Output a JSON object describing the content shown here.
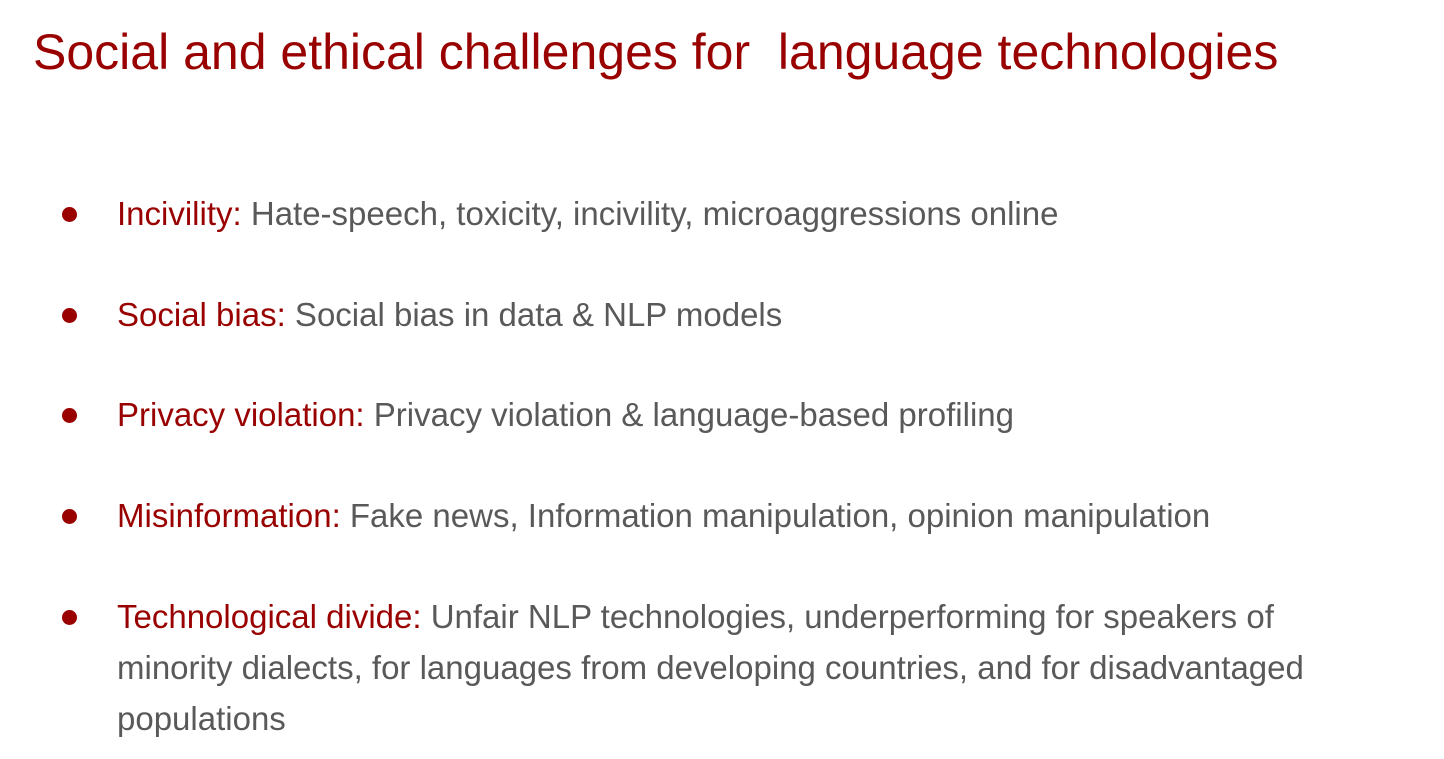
{
  "slide": {
    "title": "Social and ethical challenges for  language technologies",
    "bullets": [
      {
        "term": "Incivility:",
        "description": " Hate-speech, toxicity, incivility, microaggressions online"
      },
      {
        "term": "Social bias:",
        "description": " Social bias in data & NLP models"
      },
      {
        "term": "Privacy violation:",
        "description": " Privacy violation & language-based profiling"
      },
      {
        "term": "Misinformation:",
        "description": " Fake news, Information manipulation, opinion manipulation"
      },
      {
        "term": "Technological divide:",
        "description": " Unfair NLP technologies, underperforming for speakers of minority dialects, for languages from developing countries, and for disadvantaged populations"
      }
    ]
  },
  "colors": {
    "accent": "#990000",
    "body_text": "#595959",
    "background": "#ffffff"
  }
}
